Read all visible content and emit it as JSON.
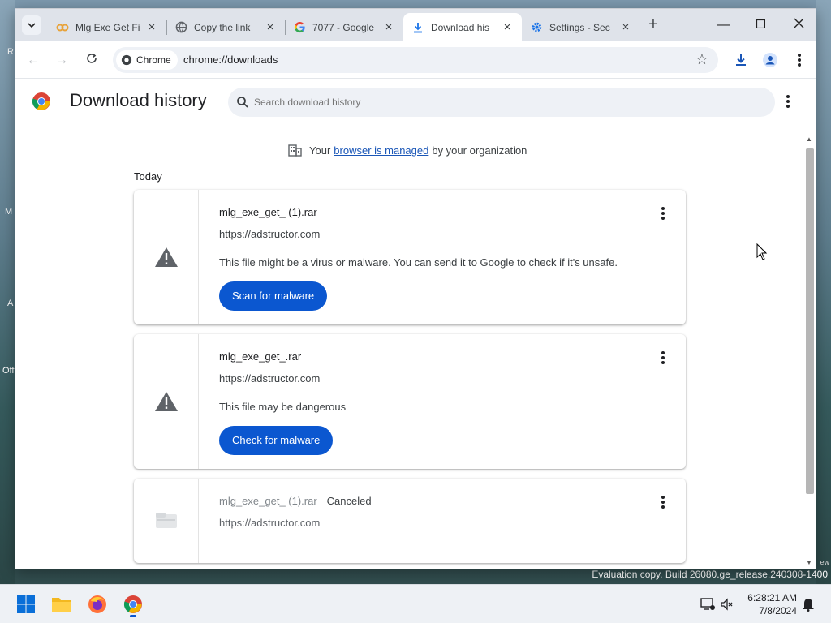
{
  "desktop": {
    "left_labels": [
      "R",
      "M",
      "A",
      "Off"
    ],
    "right_label": "ew",
    "evaluation_text": "Evaluation copy. Build 26080.ge_release.240308-1400"
  },
  "browser": {
    "tabs": [
      {
        "title": "Mlg Exe Get Fi",
        "icon": "link-chain-icon",
        "active": false
      },
      {
        "title": "Copy the link",
        "icon": "globe-icon",
        "active": false
      },
      {
        "title": "7077 - Google",
        "icon": "google-g-icon",
        "active": false
      },
      {
        "title": "Download his",
        "icon": "download-icon",
        "active": true
      },
      {
        "title": "Settings - Sec",
        "icon": "gear-icon",
        "active": false
      }
    ],
    "chip_label": "Chrome",
    "url": "chrome://downloads"
  },
  "page": {
    "title": "Download history",
    "search_placeholder": "Search download history",
    "managed": {
      "prefix": "Your",
      "link": "browser is managed",
      "suffix": "by your organization"
    },
    "date_heading": "Today",
    "downloads": [
      {
        "filename": "mlg_exe_get_ (1).rar",
        "source": "https://adstructor.com",
        "warning": "This file might be a virus or malware. You can send it to Google to check if it's unsafe.",
        "action": "Scan for malware"
      },
      {
        "filename": "mlg_exe_get_.rar",
        "source": "https://adstructor.com",
        "warning": "This file may be dangerous",
        "action": "Check for malware"
      },
      {
        "filename": "mlg_exe_get_ (1).rar",
        "status": "Canceled",
        "source": "https://adstructor.com"
      }
    ]
  },
  "taskbar": {
    "time": "6:28:21 AM",
    "date": "7/8/2024"
  },
  "colors": {
    "accent": "#0b57d0",
    "link": "#1a56b7"
  }
}
